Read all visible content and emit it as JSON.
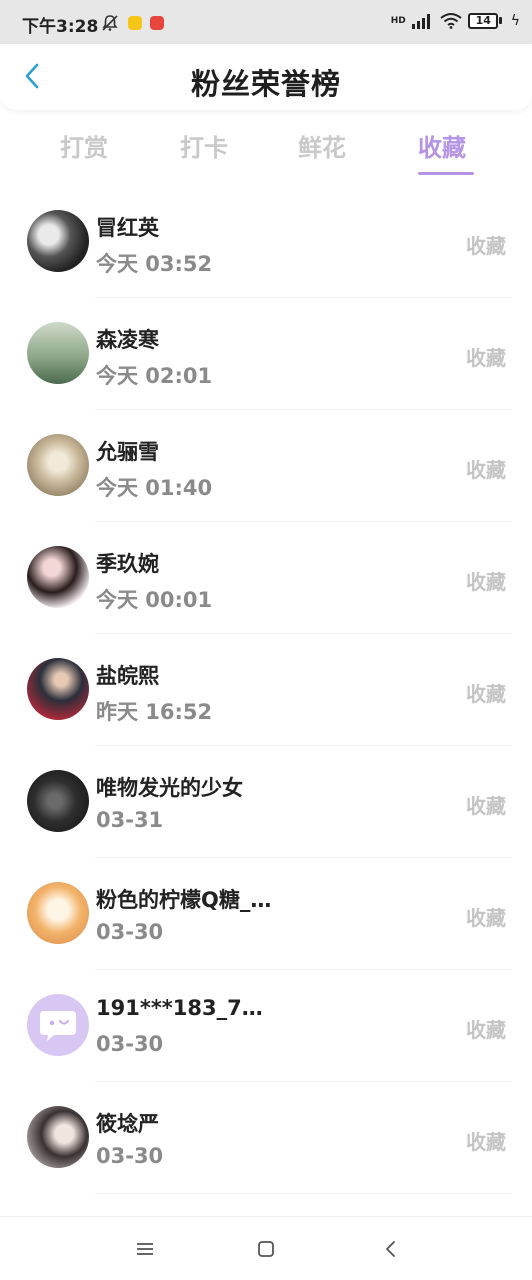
{
  "status_bar": {
    "time": "下午3:28",
    "hd": "HD",
    "battery": "14"
  },
  "header": {
    "title": "粉丝荣誉榜"
  },
  "tabs": [
    {
      "label": "打赏",
      "active": false
    },
    {
      "label": "打卡",
      "active": false
    },
    {
      "label": "鲜花",
      "active": false
    },
    {
      "label": "收藏",
      "active": true
    }
  ],
  "list": [
    {
      "name": "冒红英",
      "time": "今天 03:52",
      "action": "收藏"
    },
    {
      "name": "森凌寒",
      "time": "今天 02:01",
      "action": "收藏"
    },
    {
      "name": "允骊雪",
      "time": "今天 01:40",
      "action": "收藏"
    },
    {
      "name": "季玖婉",
      "time": "今天 00:01",
      "action": "收藏"
    },
    {
      "name": "盐皖熙",
      "time": "昨天 16:52",
      "action": "收藏"
    },
    {
      "name": "唯物发光的少女",
      "time": "03-31",
      "action": "收藏"
    },
    {
      "name": "粉色的柠檬Q糖_…",
      "time": "03-30",
      "action": "收藏"
    },
    {
      "name": "191***183_7…",
      "time": "03-30",
      "action": "收藏"
    },
    {
      "name": "筱埝严",
      "time": "03-30",
      "action": "收藏"
    }
  ],
  "colors": {
    "accent": "#b593e6",
    "tab_inactive": "#c9c9c9",
    "back_arrow": "#2a9fd6"
  },
  "icons": {
    "back": "chevron-left-icon",
    "nav_menu": "menu-icon",
    "nav_home": "square-icon",
    "nav_back": "chevron-left-icon"
  }
}
